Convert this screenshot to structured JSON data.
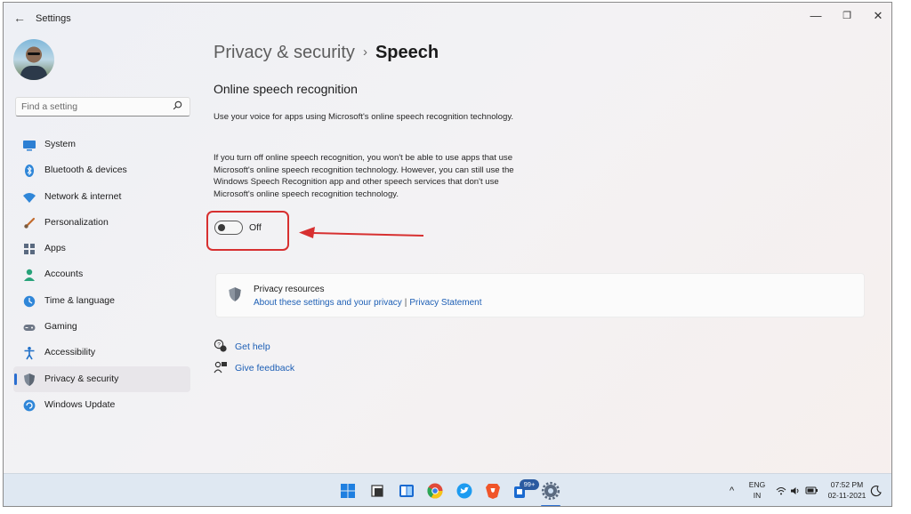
{
  "window": {
    "app_title": "Settings",
    "back_glyph": "←",
    "min_glyph": "—",
    "max_glyph": "❐",
    "close_glyph": "✕"
  },
  "sidebar": {
    "search_placeholder": "Find a setting",
    "items": [
      {
        "label": "System",
        "icon": "system-icon",
        "active": false
      },
      {
        "label": "Bluetooth & devices",
        "icon": "bluetooth-icon",
        "active": false
      },
      {
        "label": "Network & internet",
        "icon": "wifi-icon",
        "active": false
      },
      {
        "label": "Personalization",
        "icon": "brush-icon",
        "active": false
      },
      {
        "label": "Apps",
        "icon": "apps-icon",
        "active": false
      },
      {
        "label": "Accounts",
        "icon": "accounts-icon",
        "active": false
      },
      {
        "label": "Time & language",
        "icon": "globe-clock-icon",
        "active": false
      },
      {
        "label": "Gaming",
        "icon": "gamepad-icon",
        "active": false
      },
      {
        "label": "Accessibility",
        "icon": "accessibility-icon",
        "active": false
      },
      {
        "label": "Privacy & security",
        "icon": "shield-icon",
        "active": true
      },
      {
        "label": "Windows Update",
        "icon": "update-icon",
        "active": false
      }
    ]
  },
  "breadcrumb": {
    "parent": "Privacy & security",
    "separator": "›",
    "current": "Speech"
  },
  "main": {
    "section_title": "Online speech recognition",
    "description_1": "Use your voice for apps using Microsoft's online speech recognition technology.",
    "description_2": "If you turn off online speech recognition, you won't be able to use apps that use Microsoft's online speech recognition technology.  However, you can still use the Windows Speech Recognition app and other speech services that don't use Microsoft's online speech recognition technology.",
    "toggle_state": "Off",
    "toggle_on": false
  },
  "resources": {
    "title": "Privacy resources",
    "link_1": "About these settings and your privacy",
    "pipe": "|",
    "link_2": "Privacy Statement"
  },
  "help": {
    "get_help": "Get help",
    "give_feedback": "Give feedback"
  },
  "taskbar": {
    "store_badge": "99+",
    "lang_1": "ENG",
    "lang_2": "IN",
    "time": "07:52 PM",
    "date": "02-11-2021",
    "chevron_glyph": "^"
  },
  "colors": {
    "accent": "#2a6ed0",
    "link": "#1d5fb5",
    "annotation_red": "#d73030"
  }
}
